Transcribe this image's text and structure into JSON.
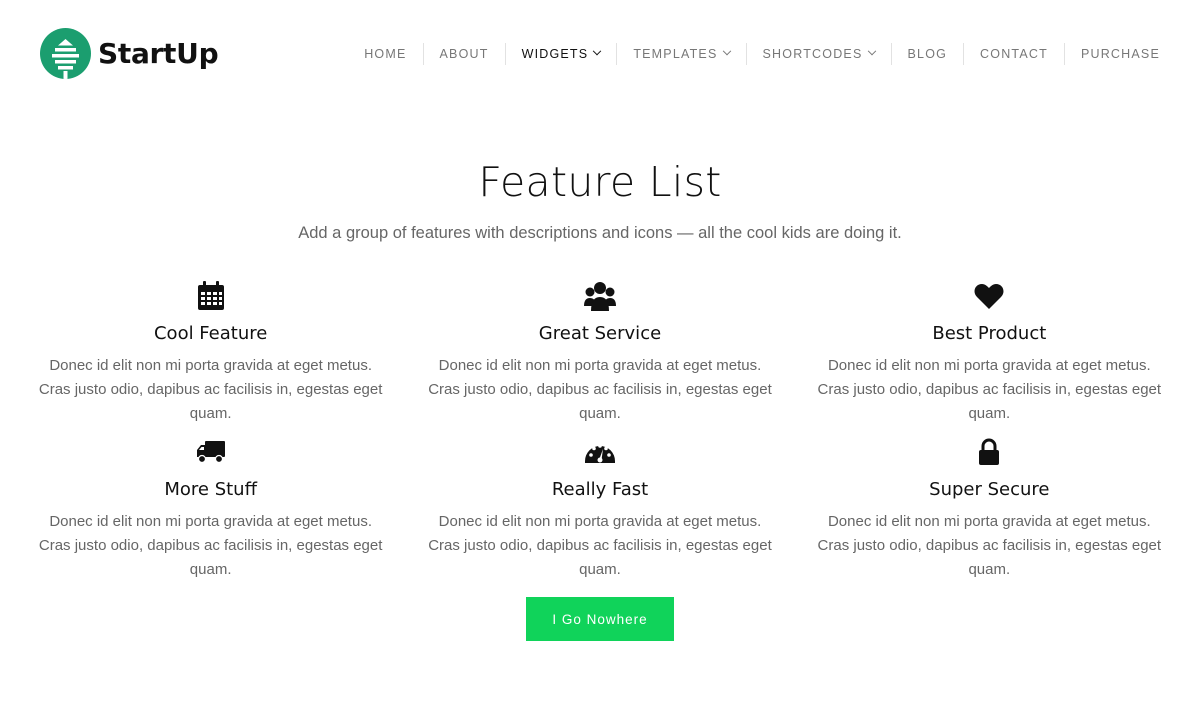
{
  "brand": {
    "name": "StartUp",
    "logo_color": "#1b9e6f"
  },
  "nav": {
    "items": [
      {
        "label": "Home",
        "dropdown": false,
        "active": false
      },
      {
        "label": "About",
        "dropdown": false,
        "active": false
      },
      {
        "label": "Widgets",
        "dropdown": true,
        "active": true
      },
      {
        "label": "Templates",
        "dropdown": true,
        "active": false
      },
      {
        "label": "Shortcodes",
        "dropdown": true,
        "active": false
      },
      {
        "label": "Blog",
        "dropdown": false,
        "active": false
      },
      {
        "label": "Contact",
        "dropdown": false,
        "active": false
      },
      {
        "label": "Purchase",
        "dropdown": false,
        "active": false
      }
    ]
  },
  "main": {
    "title": "Feature List",
    "subtitle": "Add a group of features with descriptions and icons — all the cool kids are doing it.",
    "features": [
      {
        "icon": "calendar-icon",
        "title": "Cool Feature",
        "description": "Donec id elit non mi porta gravida at eget metus. Cras justo odio, dapibus ac facilisis in, egestas eget quam."
      },
      {
        "icon": "users-icon",
        "title": "Great Service",
        "description": "Donec id elit non mi porta gravida at eget metus. Cras justo odio, dapibus ac facilisis in, egestas eget quam."
      },
      {
        "icon": "heart-icon",
        "title": "Best Product",
        "description": "Donec id elit non mi porta gravida at eget metus. Cras justo odio, dapibus ac facilisis in, egestas eget quam."
      },
      {
        "icon": "truck-icon",
        "title": "More Stuff",
        "description": "Donec id elit non mi porta gravida at eget metus. Cras justo odio, dapibus ac facilisis in, egestas eget quam."
      },
      {
        "icon": "dashboard-icon",
        "title": "Really Fast",
        "description": "Donec id elit non mi porta gravida at eget metus. Cras justo odio, dapibus ac facilisis in, egestas eget quam."
      },
      {
        "icon": "lock-icon",
        "title": "Super Secure",
        "description": "Donec id elit non mi porta gravida at eget metus. Cras justo odio, dapibus ac facilisis in, egestas eget quam."
      }
    ],
    "cta_label": "I Go Nowhere",
    "cta_color": "#10d35a"
  }
}
